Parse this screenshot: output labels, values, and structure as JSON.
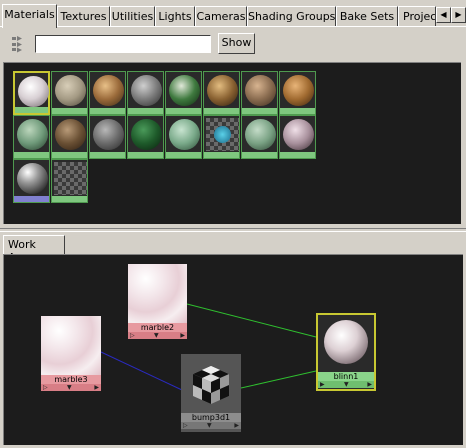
{
  "tabs": [
    {
      "label": "Materials",
      "active": true
    },
    {
      "label": "Textures"
    },
    {
      "label": "Utilities"
    },
    {
      "label": "Lights"
    },
    {
      "label": "Cameras"
    },
    {
      "label": "Shading Groups"
    },
    {
      "label": "Bake Sets"
    },
    {
      "label": "Projec"
    }
  ],
  "tab_scroll": {
    "left_icon": "triangle-left-icon",
    "right_icon": "triangle-right-icon"
  },
  "search": {
    "value": "",
    "button_label": "Show"
  },
  "materials_row1": [
    "selected",
    "stone",
    "wood",
    "grey",
    "green",
    "wood",
    "brown",
    "wood"
  ],
  "materials_row2": [
    "sage",
    "wood",
    "grey",
    "green",
    "sage",
    "checker",
    "sage",
    "marble"
  ],
  "materials_row3": [
    "chrome",
    "checker"
  ],
  "work_area": {
    "tab_label": "Work Area",
    "nodes": {
      "marble2": "marble2",
      "marble3": "marble3",
      "bump3d1": "bump3d1",
      "blinn1": "blinn1"
    }
  },
  "colors": {
    "connection_green": "#2fbf2f",
    "connection_blue": "#2a2ac0",
    "selection": "#c8c832"
  }
}
